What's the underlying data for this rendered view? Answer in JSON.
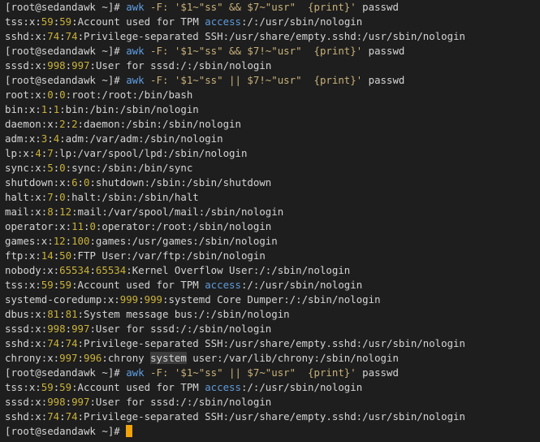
{
  "colors": {
    "background": "#1e1e1e",
    "foreground": "#d4d4d4",
    "prompt": "#d4d4d4",
    "command": "#60a0e6",
    "string": "#c9b27a",
    "colon": "#e0e0e0",
    "number": "#c9b23a",
    "keyword": "#5f9bd9",
    "highlight_bg": "#3c3c3c",
    "cursor": "#f0a30a"
  },
  "lines": [
    [
      {
        "t": "[root@sedandawk ~]# ",
        "c": "prompt"
      },
      {
        "t": "awk",
        "c": "command"
      },
      {
        "t": " -F: ",
        "c": "string"
      },
      {
        "t": "'$1~\"ss\" && $7~\"usr\"  {print}'",
        "c": "string"
      },
      {
        "t": " passwd",
        "c": "foreground"
      }
    ],
    [
      {
        "t": "tss",
        "c": "foreground"
      },
      {
        "t": ":",
        "c": "colon"
      },
      {
        "t": "x",
        "c": "foreground"
      },
      {
        "t": ":",
        "c": "colon"
      },
      {
        "t": "59",
        "c": "number"
      },
      {
        "t": ":",
        "c": "colon"
      },
      {
        "t": "59",
        "c": "number"
      },
      {
        "t": ":",
        "c": "colon"
      },
      {
        "t": "Account used for TPM ",
        "c": "foreground"
      },
      {
        "t": "access",
        "c": "keyword"
      },
      {
        "t": ":/:/usr/sbin/nologin",
        "c": "foreground"
      }
    ],
    [
      {
        "t": "sshd",
        "c": "foreground"
      },
      {
        "t": ":",
        "c": "colon"
      },
      {
        "t": "x",
        "c": "foreground"
      },
      {
        "t": ":",
        "c": "colon"
      },
      {
        "t": "74",
        "c": "number"
      },
      {
        "t": ":",
        "c": "colon"
      },
      {
        "t": "74",
        "c": "number"
      },
      {
        "t": ":",
        "c": "colon"
      },
      {
        "t": "Privilege-separated SSH:/usr/share/empty.sshd:/usr/sbin/nologin",
        "c": "foreground"
      }
    ],
    [
      {
        "t": "[root@sedandawk ~]# ",
        "c": "prompt"
      },
      {
        "t": "awk",
        "c": "command"
      },
      {
        "t": " -F: ",
        "c": "string"
      },
      {
        "t": "'$1~\"ss\" && $7!~\"usr\"  {print}'",
        "c": "string"
      },
      {
        "t": " passwd",
        "c": "foreground"
      }
    ],
    [
      {
        "t": "sssd",
        "c": "foreground"
      },
      {
        "t": ":",
        "c": "colon"
      },
      {
        "t": "x",
        "c": "foreground"
      },
      {
        "t": ":",
        "c": "colon"
      },
      {
        "t": "998",
        "c": "number"
      },
      {
        "t": ":",
        "c": "colon"
      },
      {
        "t": "997",
        "c": "number"
      },
      {
        "t": ":",
        "c": "colon"
      },
      {
        "t": "User for sssd:/:/sbin/nologin",
        "c": "foreground"
      }
    ],
    [
      {
        "t": "[root@sedandawk ~]# ",
        "c": "prompt"
      },
      {
        "t": "awk",
        "c": "command"
      },
      {
        "t": " -F: ",
        "c": "string"
      },
      {
        "t": "'$1~\"ss\" || $7!~\"usr\"  {print}'",
        "c": "string"
      },
      {
        "t": " passwd",
        "c": "foreground"
      }
    ],
    [
      {
        "t": "root:x:",
        "c": "foreground"
      },
      {
        "t": "0",
        "c": "number"
      },
      {
        "t": ":",
        "c": "colon"
      },
      {
        "t": "0",
        "c": "number"
      },
      {
        "t": ":root:/root:/bin/bash",
        "c": "foreground"
      }
    ],
    [
      {
        "t": "bin:x:",
        "c": "foreground"
      },
      {
        "t": "1",
        "c": "number"
      },
      {
        "t": ":",
        "c": "colon"
      },
      {
        "t": "1",
        "c": "number"
      },
      {
        "t": ":bin:/bin:/sbin/nologin",
        "c": "foreground"
      }
    ],
    [
      {
        "t": "daemon:x:",
        "c": "foreground"
      },
      {
        "t": "2",
        "c": "number"
      },
      {
        "t": ":",
        "c": "colon"
      },
      {
        "t": "2",
        "c": "number"
      },
      {
        "t": ":daemon:/sbin:/sbin/nologin",
        "c": "foreground"
      }
    ],
    [
      {
        "t": "adm:x:",
        "c": "foreground"
      },
      {
        "t": "3",
        "c": "number"
      },
      {
        "t": ":",
        "c": "colon"
      },
      {
        "t": "4",
        "c": "number"
      },
      {
        "t": ":adm:/var/adm:/sbin/nologin",
        "c": "foreground"
      }
    ],
    [
      {
        "t": "lp:x:",
        "c": "foreground"
      },
      {
        "t": "4",
        "c": "number"
      },
      {
        "t": ":",
        "c": "colon"
      },
      {
        "t": "7",
        "c": "number"
      },
      {
        "t": ":lp:/var/spool/lpd:/sbin/nologin",
        "c": "foreground"
      }
    ],
    [
      {
        "t": "sync:x:",
        "c": "foreground"
      },
      {
        "t": "5",
        "c": "number"
      },
      {
        "t": ":",
        "c": "colon"
      },
      {
        "t": "0",
        "c": "number"
      },
      {
        "t": ":sync:/sbin:/bin/sync",
        "c": "foreground"
      }
    ],
    [
      {
        "t": "shutdown:x:",
        "c": "foreground"
      },
      {
        "t": "6",
        "c": "number"
      },
      {
        "t": ":",
        "c": "colon"
      },
      {
        "t": "0",
        "c": "number"
      },
      {
        "t": ":shutdown:/sbin:/sbin/shutdown",
        "c": "foreground"
      }
    ],
    [
      {
        "t": "halt:x:",
        "c": "foreground"
      },
      {
        "t": "7",
        "c": "number"
      },
      {
        "t": ":",
        "c": "colon"
      },
      {
        "t": "0",
        "c": "number"
      },
      {
        "t": ":halt:/sbin:/sbin/halt",
        "c": "foreground"
      }
    ],
    [
      {
        "t": "mail:x:",
        "c": "foreground"
      },
      {
        "t": "8",
        "c": "number"
      },
      {
        "t": ":",
        "c": "colon"
      },
      {
        "t": "12",
        "c": "number"
      },
      {
        "t": ":mail:/var/spool/mail:/sbin/nologin",
        "c": "foreground"
      }
    ],
    [
      {
        "t": "operator:x:",
        "c": "foreground"
      },
      {
        "t": "11",
        "c": "number"
      },
      {
        "t": ":",
        "c": "colon"
      },
      {
        "t": "0",
        "c": "number"
      },
      {
        "t": ":operator:/root:/sbin/nologin",
        "c": "foreground"
      }
    ],
    [
      {
        "t": "games:x:",
        "c": "foreground"
      },
      {
        "t": "12",
        "c": "number"
      },
      {
        "t": ":",
        "c": "colon"
      },
      {
        "t": "100",
        "c": "number"
      },
      {
        "t": ":games:/usr/games:/sbin/nologin",
        "c": "foreground"
      }
    ],
    [
      {
        "t": "ftp:x:",
        "c": "foreground"
      },
      {
        "t": "14",
        "c": "number"
      },
      {
        "t": ":",
        "c": "colon"
      },
      {
        "t": "50",
        "c": "number"
      },
      {
        "t": ":FTP User:/var/ftp:/sbin/nologin",
        "c": "foreground"
      }
    ],
    [
      {
        "t": "nobody:x:",
        "c": "foreground"
      },
      {
        "t": "65534",
        "c": "number"
      },
      {
        "t": ":",
        "c": "colon"
      },
      {
        "t": "65534",
        "c": "number"
      },
      {
        "t": ":Kernel Overflow User:/:/sbin/nologin",
        "c": "foreground"
      }
    ],
    [
      {
        "t": "tss:x:",
        "c": "foreground"
      },
      {
        "t": "59",
        "c": "number"
      },
      {
        "t": ":",
        "c": "colon"
      },
      {
        "t": "59",
        "c": "number"
      },
      {
        "t": ":Account used for TPM ",
        "c": "foreground"
      },
      {
        "t": "access",
        "c": "keyword"
      },
      {
        "t": ":/:/usr/sbin/nologin",
        "c": "foreground"
      }
    ],
    [
      {
        "t": "systemd-coredump:x:",
        "c": "foreground"
      },
      {
        "t": "999",
        "c": "number"
      },
      {
        "t": ":",
        "c": "colon"
      },
      {
        "t": "999",
        "c": "number"
      },
      {
        "t": ":systemd Core Dumper:/:/sbin/nologin",
        "c": "foreground"
      }
    ],
    [
      {
        "t": "dbus:x:",
        "c": "foreground"
      },
      {
        "t": "81",
        "c": "number"
      },
      {
        "t": ":",
        "c": "colon"
      },
      {
        "t": "81",
        "c": "number"
      },
      {
        "t": ":System message bus:/:/sbin/nologin",
        "c": "foreground"
      }
    ],
    [
      {
        "t": "sssd:x:",
        "c": "foreground"
      },
      {
        "t": "998",
        "c": "number"
      },
      {
        "t": ":",
        "c": "colon"
      },
      {
        "t": "997",
        "c": "number"
      },
      {
        "t": ":User for sssd:/:/sbin/nologin",
        "c": "foreground"
      }
    ],
    [
      {
        "t": "sshd:x:",
        "c": "foreground"
      },
      {
        "t": "74",
        "c": "number"
      },
      {
        "t": ":",
        "c": "colon"
      },
      {
        "t": "74",
        "c": "number"
      },
      {
        "t": ":Privilege-separated SSH:/usr/share/empty.sshd:/usr/sbin/nologin",
        "c": "foreground"
      }
    ],
    [
      {
        "t": "chrony:x:",
        "c": "foreground"
      },
      {
        "t": "997",
        "c": "number"
      },
      {
        "t": ":",
        "c": "colon"
      },
      {
        "t": "996",
        "c": "number"
      },
      {
        "t": ":chrony ",
        "c": "foreground"
      },
      {
        "t": "system",
        "c": "foreground",
        "hl": true
      },
      {
        "t": " user:/var/lib/chrony:/sbin/nologin",
        "c": "foreground"
      }
    ],
    [
      {
        "t": "[root@sedandawk ~]# ",
        "c": "prompt"
      },
      {
        "t": "awk",
        "c": "command"
      },
      {
        "t": " -F: ",
        "c": "string"
      },
      {
        "t": "'$1~\"ss\" || $7~\"usr\"  {print}'",
        "c": "string"
      },
      {
        "t": " passwd",
        "c": "foreground"
      }
    ],
    [
      {
        "t": "tss:x:",
        "c": "foreground"
      },
      {
        "t": "59",
        "c": "number"
      },
      {
        "t": ":",
        "c": "colon"
      },
      {
        "t": "59",
        "c": "number"
      },
      {
        "t": ":Account used for TPM ",
        "c": "foreground"
      },
      {
        "t": "access",
        "c": "keyword"
      },
      {
        "t": ":/:/usr/sbin/nologin",
        "c": "foreground"
      }
    ],
    [
      {
        "t": "sssd:x:",
        "c": "foreground"
      },
      {
        "t": "998",
        "c": "number"
      },
      {
        "t": ":",
        "c": "colon"
      },
      {
        "t": "997",
        "c": "number"
      },
      {
        "t": ":User for sssd:/:/sbin/nologin",
        "c": "foreground"
      }
    ],
    [
      {
        "t": "sshd:x:",
        "c": "foreground"
      },
      {
        "t": "74",
        "c": "number"
      },
      {
        "t": ":",
        "c": "colon"
      },
      {
        "t": "74",
        "c": "number"
      },
      {
        "t": ":Privilege-separated SSH:/usr/share/empty.sshd:/usr/sbin/nologin",
        "c": "foreground"
      }
    ],
    [
      {
        "t": "[root@sedandawk ~]# ",
        "c": "prompt"
      }
    ]
  ],
  "cursor_icon": "block-cursor"
}
